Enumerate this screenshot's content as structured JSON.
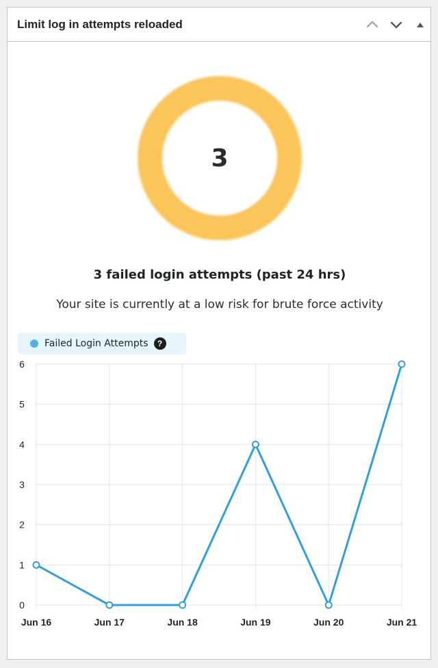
{
  "widget": {
    "title": "Limit log in attempts reloaded",
    "controls": {
      "move_up_icon": "chevron-up-icon",
      "move_down_icon": "chevron-down-icon",
      "toggle_icon": "triangle-up-icon"
    }
  },
  "summary": {
    "count": "3",
    "donut_color": "#fcc55a",
    "title": "3 failed login attempts (past 24 hrs)",
    "description": "Your site is currently at a low risk for brute force activity"
  },
  "legend": {
    "label": "Failed Login Attempts",
    "help_glyph": "?",
    "help_icon": "question-circle-icon",
    "color": "#4fb3e8"
  },
  "chart_data": {
    "type": "line",
    "title": "",
    "xlabel": "",
    "ylabel": "",
    "categories": [
      "Jun 16",
      "Jun 17",
      "Jun 18",
      "Jun 19",
      "Jun 20",
      "Jun 21"
    ],
    "series": [
      {
        "name": "Failed Login Attempts",
        "values": [
          1,
          0,
          0,
          4,
          0,
          6
        ],
        "color": "#2f9fe0"
      }
    ],
    "yticks": [
      0,
      1,
      2,
      3,
      4,
      5,
      6
    ],
    "ylim": [
      0,
      6
    ],
    "grid": true,
    "legend_position": "top-left"
  }
}
